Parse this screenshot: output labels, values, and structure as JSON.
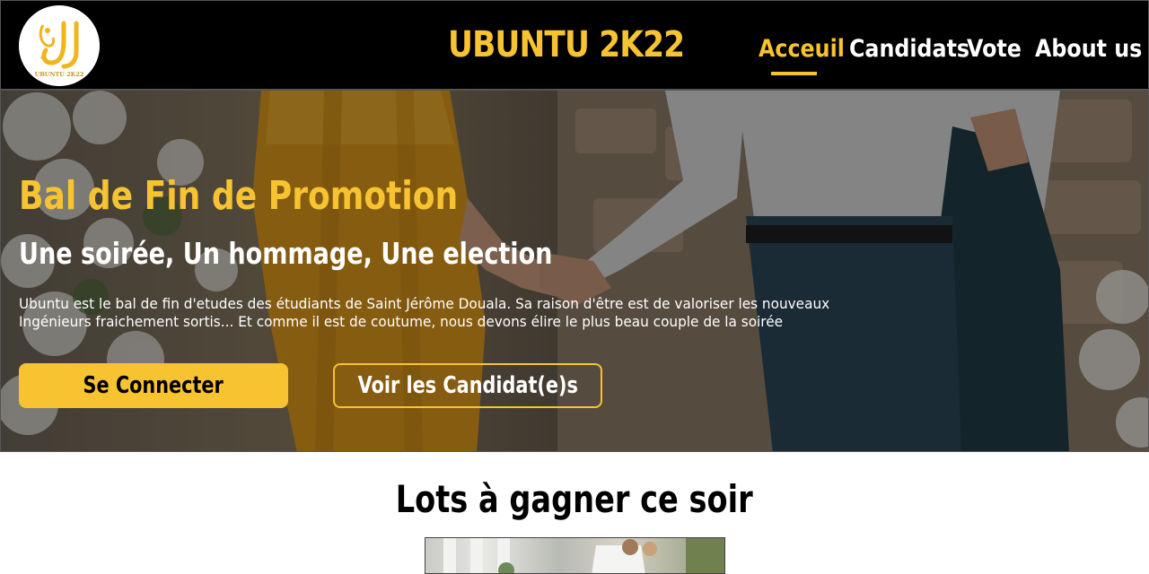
{
  "header": {
    "logo_text": "UBUNTU 2K22",
    "title": "UBUNTU 2K22",
    "nav": [
      {
        "label": "Acceuil",
        "active": true
      },
      {
        "label": "Candidats",
        "active": false
      },
      {
        "label": "Vote",
        "active": false
      },
      {
        "label": "About us",
        "active": false
      }
    ]
  },
  "hero": {
    "title": "Bal de Fin de Promotion",
    "subtitle": "Une soirée, Un hommage, Une election",
    "text_line1": "Ubuntu est le bal de fin d'etudes des étudiants de Saint Jérôme Douala. Sa raison d'être est de valoriser les nouveaux",
    "text_line2": "Ingénieurs fraichement sortis... Et comme il est de coutume, nous devons élire le plus beau couple de la soirée",
    "login_button": "Se Connecter",
    "candidates_button": "Voir les Candidat(e)s"
  },
  "prizes": {
    "title": "Lots à gagner ce soir"
  },
  "colors": {
    "accent": "#f7c331",
    "header_bg": "#000000",
    "text_light": "#ffffff"
  }
}
